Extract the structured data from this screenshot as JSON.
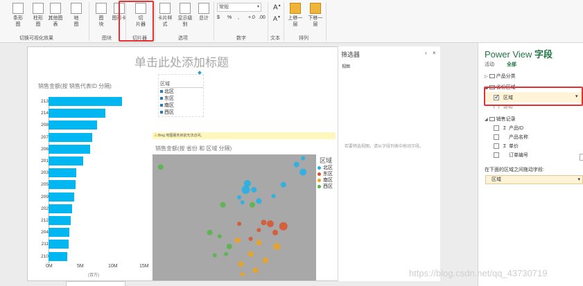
{
  "ribbon": {
    "buttons": [
      {
        "label": "条形\n图",
        "icon": "bar-chart-icon"
      },
      {
        "label": "柱形\n图",
        "icon": "column-chart-icon"
      },
      {
        "label": "其他图\n表",
        "icon": "other-chart-icon"
      },
      {
        "label": "地\n图",
        "icon": "globe-icon"
      },
      {
        "label": "图\n块",
        "icon": "tiles-icon"
      },
      {
        "label": "图形卡",
        "icon": "cards-icon"
      },
      {
        "label": "切\n片器",
        "icon": "slicer-icon"
      },
      {
        "label": "卡片样\n式",
        "icon": "card-style-icon"
      },
      {
        "label": "显示级\n别",
        "icon": "show-levels-icon"
      },
      {
        "label": "总计",
        "icon": "totals-icon"
      },
      {
        "label": "上移一\n层",
        "icon": "bring-forward-icon"
      },
      {
        "label": "下移一\n层",
        "icon": "send-backward-icon"
      }
    ],
    "groups": [
      "切换可视化效果",
      "图块",
      "切片器",
      "选项",
      "数字",
      "文本",
      "排列"
    ],
    "number_format": "常规",
    "number_symbols": [
      "$",
      "%",
      ",",
      "+.0",
      ".00"
    ]
  },
  "canvas": {
    "title": "单击此处添加标题"
  },
  "bar_chart": {
    "title": "销售金额(按 销售代表ID 分隔)",
    "x_unit": "(百万)"
  },
  "chart_data": {
    "type": "bar",
    "orientation": "horizontal",
    "title": "销售金额(按 销售代表ID 分隔)",
    "categories": [
      "213",
      "214",
      "208",
      "207",
      "206",
      "201",
      "203",
      "205",
      "209",
      "202",
      "212",
      "204",
      "211",
      "210"
    ],
    "values": [
      11.8,
      9.1,
      7.8,
      7.0,
      6.7,
      5.6,
      4.4,
      4.3,
      4.1,
      3.8,
      3.5,
      3.3,
      3.2,
      3.0
    ],
    "xlim": [
      0,
      15
    ],
    "xticks": [
      "0M",
      "5M",
      "10M",
      "15M"
    ],
    "xlabel": "(百万)",
    "color": "#00b7f1"
  },
  "slicer": {
    "header": "区域",
    "items": [
      "北区",
      "东区",
      "南区",
      "西区"
    ]
  },
  "map_visual": {
    "warning": "Bing 地图服务目前无法访问。",
    "title": "销售金额(按 省份 和 区域 分隔)",
    "legend_title": "区域",
    "legend": [
      {
        "name": "北区",
        "color": "#1fb2e6"
      },
      {
        "name": "东区",
        "color": "#d9532b"
      },
      {
        "name": "南区",
        "color": "#eea31d"
      },
      {
        "name": "西区",
        "color": "#55b548"
      }
    ],
    "points": [
      {
        "lon": 0.05,
        "lat": 0.1,
        "r": 4,
        "region": 3
      },
      {
        "lon": 0.92,
        "lat": 0.03,
        "r": 3,
        "region": 0
      },
      {
        "lon": 0.88,
        "lat": 0.08,
        "r": 4,
        "region": 0
      },
      {
        "lon": 0.92,
        "lat": 0.14,
        "r": 5,
        "region": 0
      },
      {
        "lon": 0.8,
        "lat": 0.24,
        "r": 4,
        "region": 0
      },
      {
        "lon": 0.74,
        "lat": 0.33,
        "r": 3,
        "region": 0
      },
      {
        "lon": 0.58,
        "lat": 0.23,
        "r": 5,
        "region": 0
      },
      {
        "lon": 0.57,
        "lat": 0.28,
        "r": 6,
        "region": 0
      },
      {
        "lon": 0.62,
        "lat": 0.28,
        "r": 4,
        "region": 0
      },
      {
        "lon": 0.65,
        "lat": 0.37,
        "r": 4,
        "region": 0
      },
      {
        "lon": 0.53,
        "lat": 0.34,
        "r": 3,
        "region": 0
      },
      {
        "lon": 0.55,
        "lat": 0.38,
        "r": 3,
        "region": 0
      },
      {
        "lon": 0.61,
        "lat": 0.4,
        "r": 4,
        "region": 3
      },
      {
        "lon": 0.43,
        "lat": 0.4,
        "r": 4,
        "region": 3
      },
      {
        "lon": 0.68,
        "lat": 0.54,
        "r": 4,
        "region": 1
      },
      {
        "lon": 0.72,
        "lat": 0.55,
        "r": 5,
        "region": 1
      },
      {
        "lon": 0.8,
        "lat": 0.57,
        "r": 6,
        "region": 1
      },
      {
        "lon": 0.75,
        "lat": 0.62,
        "r": 4,
        "region": 1
      },
      {
        "lon": 0.65,
        "lat": 0.6,
        "r": 3,
        "region": 1
      },
      {
        "lon": 0.53,
        "lat": 0.55,
        "r": 3,
        "region": 1
      },
      {
        "lon": 0.6,
        "lat": 0.67,
        "r": 3,
        "region": 1
      },
      {
        "lon": 0.65,
        "lat": 0.7,
        "r": 4,
        "region": 2
      },
      {
        "lon": 0.52,
        "lat": 0.68,
        "r": 4,
        "region": 2
      },
      {
        "lon": 0.35,
        "lat": 0.62,
        "r": 4,
        "region": 3
      },
      {
        "lon": 0.41,
        "lat": 0.65,
        "r": 3,
        "region": 3
      },
      {
        "lon": 0.47,
        "lat": 0.73,
        "r": 4,
        "region": 3
      },
      {
        "lon": 0.45,
        "lat": 0.79,
        "r": 3,
        "region": 3
      },
      {
        "lon": 0.38,
        "lat": 0.8,
        "r": 3,
        "region": 3
      },
      {
        "lon": 0.6,
        "lat": 0.79,
        "r": 4,
        "region": 2
      },
      {
        "lon": 0.76,
        "lat": 0.73,
        "r": 5,
        "region": 2
      },
      {
        "lon": 0.69,
        "lat": 0.84,
        "r": 4,
        "region": 2
      },
      {
        "lon": 0.54,
        "lat": 0.87,
        "r": 4,
        "region": 2
      },
      {
        "lon": 0.63,
        "lat": 0.92,
        "r": 4,
        "region": 2
      },
      {
        "lon": 0.55,
        "lat": 0.95,
        "r": 3,
        "region": 2
      }
    ]
  },
  "filter_pane": {
    "title": "筛选器",
    "tab": "视图",
    "hint": "若要筛选视图，请从字段列表中拖动字段。",
    "controls": [
      "‹",
      "×"
    ]
  },
  "fields_pane": {
    "title_prefix": "Power View ",
    "title_suffix": "字段",
    "tabs": [
      "活动",
      "全部"
    ],
    "tables": [
      {
        "name": "产品分类",
        "expanded": false
      },
      {
        "name": "省份区域",
        "expanded": true
      },
      {
        "name": "销售记录",
        "expanded": true
      }
    ],
    "region_fields": [
      {
        "name": "区域",
        "checked": true
      },
      {
        "name": "省份",
        "checked": false
      }
    ],
    "sales_fields": [
      {
        "name": "产品ID",
        "sigma": true
      },
      {
        "name": "产品名称",
        "sigma": false
      },
      {
        "name": "单价",
        "sigma": true
      },
      {
        "name": "订单编号",
        "sigma": false
      }
    ],
    "drop_label": "在下面的区域之间拖动字段:",
    "drop_value": "区域"
  },
  "watermark": "https://blog.csdn.net/qq_43730719"
}
